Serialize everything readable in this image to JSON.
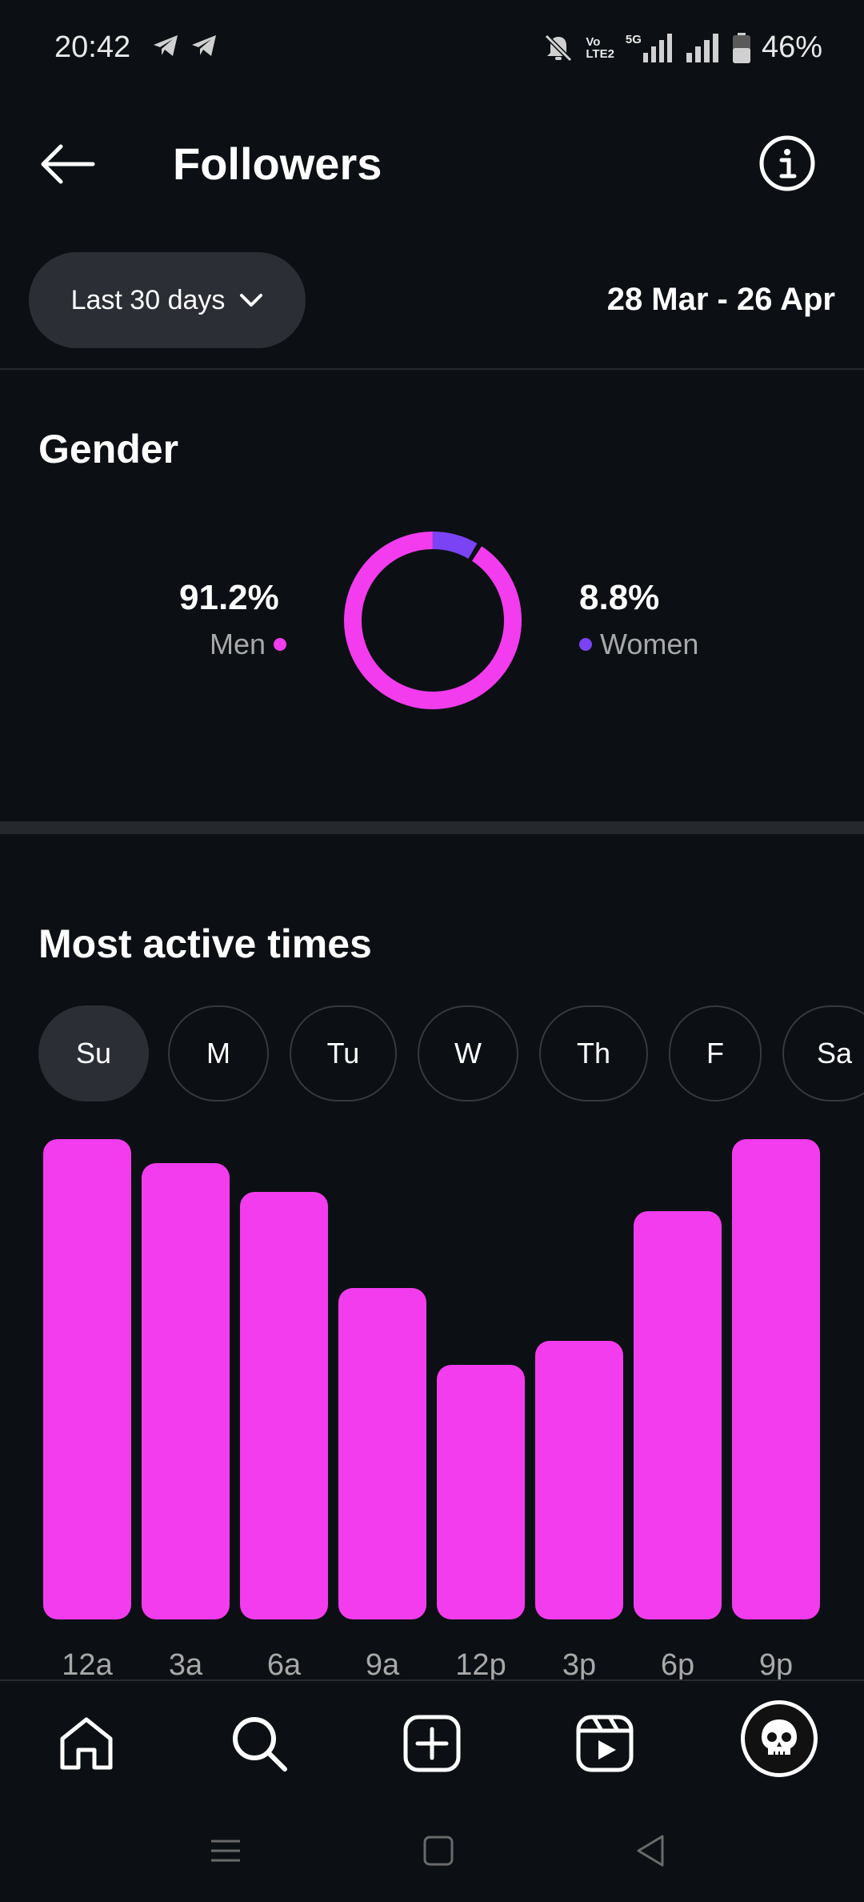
{
  "status_bar": {
    "time": "20:42",
    "network_label_top": "Vo",
    "network_label_bottom": "LTE2",
    "network_5g": "5G",
    "battery": "46%"
  },
  "header": {
    "title": "Followers",
    "back_icon": "arrow-left-icon",
    "info_icon": "info-icon"
  },
  "filter": {
    "range_label": "Last 30 days",
    "date_range": "28 Mar - 26 Apr"
  },
  "gender": {
    "title": "Gender",
    "men_percent": "91.2%",
    "men_label": "Men",
    "women_percent": "8.8%",
    "women_label": "Women",
    "men_color": "#f23cee",
    "women_color": "#7a44f5",
    "men_fraction": 0.912,
    "women_fraction": 0.088
  },
  "active_times": {
    "title": "Most active times",
    "days": [
      "Su",
      "M",
      "Tu",
      "W",
      "Th",
      "F",
      "Sa"
    ],
    "selected_day": "Su"
  },
  "chart_data": {
    "type": "bar",
    "categories": [
      "12a",
      "3a",
      "6a",
      "9a",
      "12p",
      "3p",
      "6p",
      "9p"
    ],
    "values": [
      100,
      95,
      89,
      69,
      53,
      58,
      85,
      100
    ],
    "ylim": [
      0,
      100
    ],
    "bar_color": "#f23cee",
    "grid": false
  },
  "bottom_nav": {
    "items": [
      "home-icon",
      "search-icon",
      "create-icon",
      "reels-icon",
      "profile-avatar"
    ]
  }
}
